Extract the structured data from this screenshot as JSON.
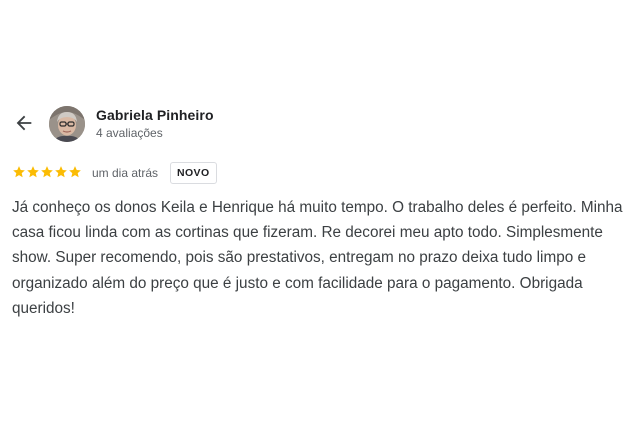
{
  "reviewer": {
    "name": "Gabriela Pinheiro",
    "subtitle": "4 avaliações"
  },
  "review": {
    "rating": 5,
    "rating_max": 5,
    "time": "um dia atrás",
    "badge": "NOVO",
    "text": "Já conheço os donos Keila e Henrique há muito tempo. O trabalho deles é perfeito. Minha casa ficou linda com as cortinas que fizeram. Re decorei meu apto todo. Simplesmente show. Super recomendo, pois são prestativos, entregam no prazo deixa tudo limpo e organizado além do preço que é justo e com facilidade para o pagamento. Obrigada queridos!"
  },
  "icons": {
    "back": "arrow-back-icon",
    "star": "star-icon"
  },
  "colors": {
    "star": "#fbbc04",
    "text": "#3c4043",
    "secondary": "#5f6368"
  }
}
